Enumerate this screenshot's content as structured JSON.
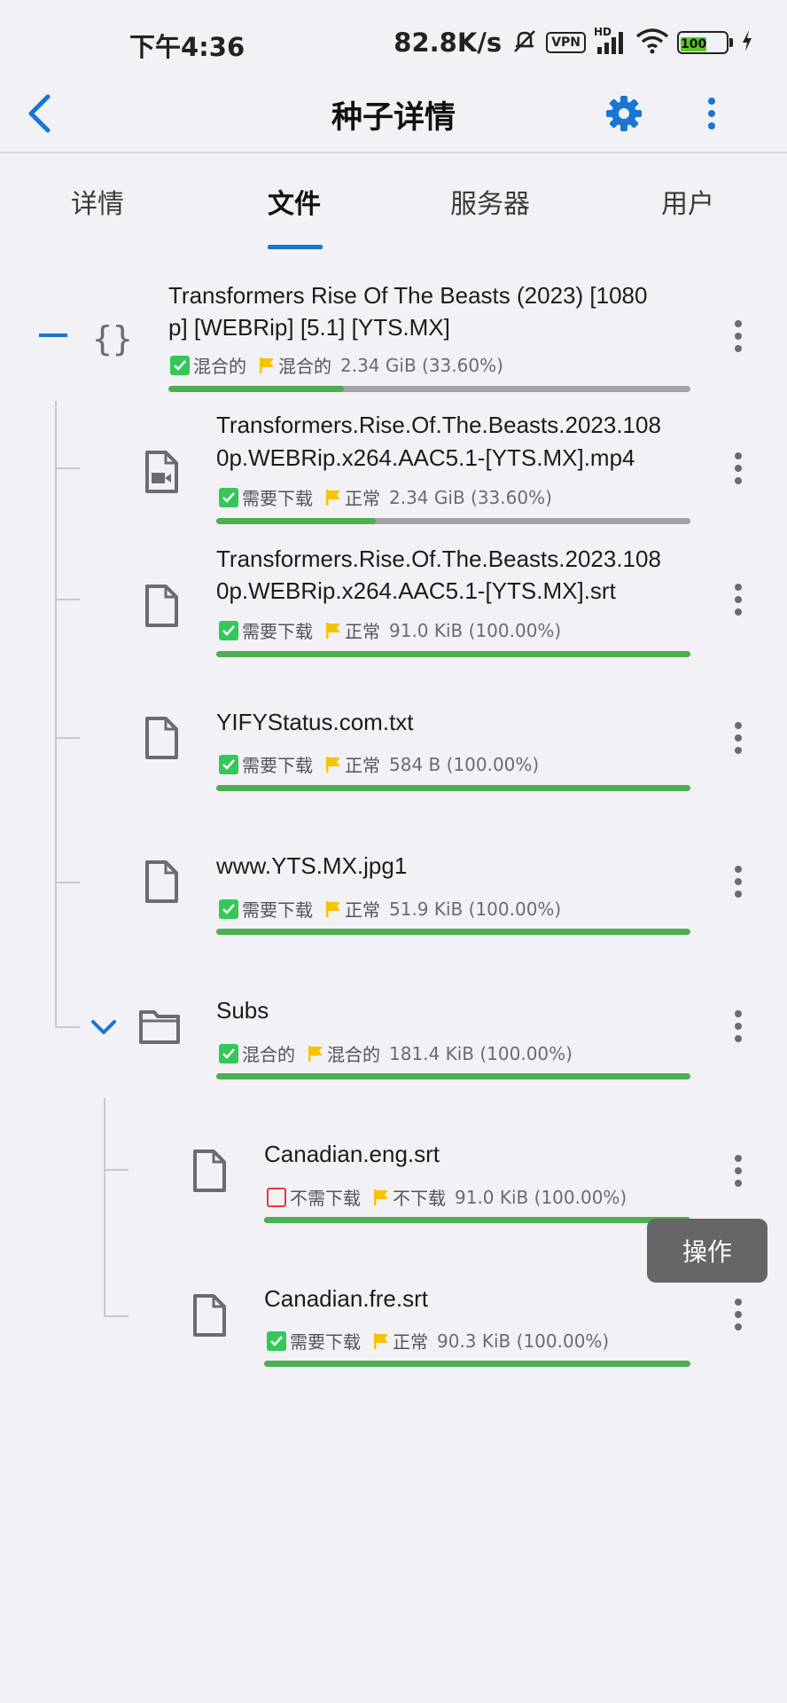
{
  "status_bar": {
    "time": "下午4:36",
    "speed": "82.8K/s",
    "vpn": "VPN",
    "network": "HD",
    "battery": "100"
  },
  "app_bar": {
    "title": "种子详情"
  },
  "tabs": [
    {
      "label": "详情",
      "active": false
    },
    {
      "label": "文件",
      "active": true
    },
    {
      "label": "服务器",
      "active": false
    },
    {
      "label": "用户",
      "active": false
    }
  ],
  "colors": {
    "accent": "#1976d2",
    "progress": "#4caf50",
    "progress_track": "#a3a2a8",
    "check_on": "#34c759",
    "check_off": "#e53935",
    "flag": "#f5c400"
  },
  "files": {
    "root": {
      "name_line1": "Transformers Rise Of The Beasts (2023) [1080",
      "name_line2": "p] [WEBRip] [5.1] [YTS.MX]",
      "check_label": "混合的",
      "priority_label": "混合的",
      "size": "2.34 GiB (33.60%)",
      "progress": 0.336,
      "icon": "torrent-braces-icon"
    },
    "children": [
      {
        "name_line1": "Transformers.Rise.Of.The.Beasts.2023.108",
        "name_line2": "0p.WEBRip.x264.AAC5.1-[YTS.MX].mp4",
        "check_label": "需要下载",
        "checked": true,
        "priority_label": "正常",
        "size": "2.34 GiB (33.60%)",
        "progress": 0.336,
        "icon": "video-file-icon"
      },
      {
        "name_line1": "Transformers.Rise.Of.The.Beasts.2023.108",
        "name_line2": "0p.WEBRip.x264.AAC5.1-[YTS.MX].srt",
        "check_label": "需要下载",
        "checked": true,
        "priority_label": "正常",
        "size": "91.0 KiB (100.00%)",
        "progress": 1.0,
        "icon": "file-icon"
      },
      {
        "name_line1": "YIFYStatus.com.txt",
        "check_label": "需要下载",
        "checked": true,
        "priority_label": "正常",
        "size": "584 B (100.00%)",
        "progress": 1.0,
        "icon": "file-icon"
      },
      {
        "name_line1": "www.YTS.MX.jpg1",
        "check_label": "需要下载",
        "checked": true,
        "priority_label": "正常",
        "size": "51.9 KiB (100.00%)",
        "progress": 1.0,
        "icon": "file-icon"
      },
      {
        "name_line1": "Subs",
        "check_label": "混合的",
        "checked": true,
        "priority_label": "混合的",
        "size": "181.4 KiB (100.00%)",
        "progress": 1.0,
        "icon": "folder-icon"
      }
    ],
    "subs_children": [
      {
        "name_line1": "Canadian.eng.srt",
        "check_label": "不需下载",
        "checked": false,
        "priority_label": "不下载",
        "size": "91.0 KiB (100.00%)",
        "progress": 1.0,
        "icon": "file-icon"
      },
      {
        "name_line1": "Canadian.fre.srt",
        "check_label": "需要下载",
        "checked": true,
        "priority_label": "正常",
        "size": "90.3 KiB (100.00%)",
        "progress": 1.0,
        "icon": "file-icon"
      }
    ]
  },
  "tooltip": {
    "label": "操作"
  }
}
